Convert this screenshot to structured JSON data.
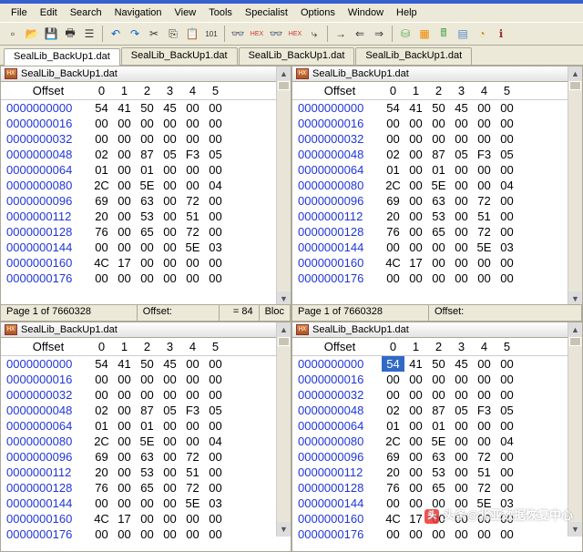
{
  "menu": [
    "File",
    "Edit",
    "Search",
    "Navigation",
    "View",
    "Tools",
    "Specialist",
    "Options",
    "Window",
    "Help"
  ],
  "tabs": [
    "SealLib_BackUp1.dat",
    "SealLib_BackUp1.dat",
    "SealLib_BackUp1.dat",
    "SealLib_BackUp1.dat"
  ],
  "header": {
    "offset_label": "Offset",
    "cols": [
      "0",
      "1",
      "2",
      "3",
      "4",
      "5"
    ]
  },
  "rows": [
    {
      "addr": "0000000000",
      "b": [
        "54",
        "41",
        "50",
        "45",
        "00",
        "00"
      ]
    },
    {
      "addr": "0000000016",
      "b": [
        "00",
        "00",
        "00",
        "00",
        "00",
        "00"
      ]
    },
    {
      "addr": "0000000032",
      "b": [
        "00",
        "00",
        "00",
        "00",
        "00",
        "00"
      ]
    },
    {
      "addr": "0000000048",
      "b": [
        "02",
        "00",
        "87",
        "05",
        "F3",
        "05"
      ]
    },
    {
      "addr": "0000000064",
      "b": [
        "01",
        "00",
        "01",
        "00",
        "00",
        "00"
      ]
    },
    {
      "addr": "0000000080",
      "b": [
        "2C",
        "00",
        "5E",
        "00",
        "00",
        "04"
      ]
    },
    {
      "addr": "0000000096",
      "b": [
        "69",
        "00",
        "63",
        "00",
        "72",
        "00"
      ]
    },
    {
      "addr": "0000000112",
      "b": [
        "20",
        "00",
        "53",
        "00",
        "51",
        "00"
      ]
    },
    {
      "addr": "0000000128",
      "b": [
        "76",
        "00",
        "65",
        "00",
        "72",
        "00"
      ]
    },
    {
      "addr": "0000000144",
      "b": [
        "00",
        "00",
        "00",
        "00",
        "5E",
        "03"
      ]
    },
    {
      "addr": "0000000160",
      "b": [
        "4C",
        "17",
        "00",
        "00",
        "00",
        "00"
      ]
    },
    {
      "addr": "0000000176",
      "b": [
        "00",
        "00",
        "00",
        "00",
        "00",
        "00"
      ]
    }
  ],
  "pane_title": "SealLib_BackUp1.dat",
  "status": {
    "page": "Page 1 of 7660328",
    "offset_lbl": "Offset:",
    "eq": "= 84",
    "block": "Bloc",
    "page2": "Page 1 of 7660328",
    "offset2": "Offset:"
  },
  "watermark": "头条@北亚数据恢复中心"
}
